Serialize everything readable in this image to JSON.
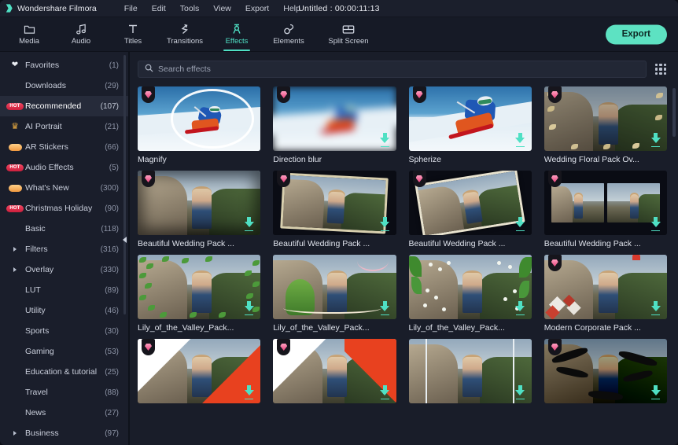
{
  "app": {
    "brand": "Wondershare Filmora",
    "project_title": "Untitled : 00:00:11:13",
    "accent": "#4fe0c4",
    "badge_color": "#e8447e",
    "hot_color": "#cc1f3c"
  },
  "menu": [
    {
      "label": "File"
    },
    {
      "label": "Edit"
    },
    {
      "label": "Tools"
    },
    {
      "label": "View"
    },
    {
      "label": "Export"
    },
    {
      "label": "Help"
    }
  ],
  "toolbar": {
    "tabs": [
      {
        "label": "Media",
        "icon": "folder-icon",
        "active": false
      },
      {
        "label": "Audio",
        "icon": "music-note-icon",
        "active": false
      },
      {
        "label": "Titles",
        "icon": "text-t-icon",
        "active": false
      },
      {
        "label": "Transitions",
        "icon": "transitions-icon",
        "active": false
      },
      {
        "label": "Effects",
        "icon": "effects-icon",
        "active": true
      },
      {
        "label": "Elements",
        "icon": "elements-icon",
        "active": false
      },
      {
        "label": "Split Screen",
        "icon": "split-screen-icon",
        "active": false
      }
    ],
    "export_label": "Export"
  },
  "search": {
    "placeholder": "Search effects",
    "value": ""
  },
  "sidebar": {
    "items": [
      {
        "label": "Favorites",
        "count": "(1)",
        "icon": "heart-icon",
        "selected": false,
        "expandable": false
      },
      {
        "label": "Downloads",
        "count": "(29)",
        "icon": "none",
        "selected": false,
        "expandable": false
      },
      {
        "label": "Recommended",
        "count": "(107)",
        "icon": "hot-badge",
        "selected": true,
        "expandable": false
      },
      {
        "label": "AI Portrait",
        "count": "(21)",
        "icon": "crown-icon",
        "selected": false,
        "expandable": false
      },
      {
        "label": "AR Stickers",
        "count": "(66)",
        "icon": "pill-icon",
        "selected": false,
        "expandable": false
      },
      {
        "label": "Audio Effects",
        "count": "(5)",
        "icon": "hot-badge",
        "selected": false,
        "expandable": false
      },
      {
        "label": "What's New",
        "count": "(300)",
        "icon": "pill-icon",
        "selected": false,
        "expandable": false
      },
      {
        "label": "Christmas Holiday",
        "count": "(90)",
        "icon": "hot-badge",
        "selected": false,
        "expandable": false
      },
      {
        "label": "Basic",
        "count": "(118)",
        "icon": "none",
        "selected": false,
        "expandable": false
      },
      {
        "label": "Filters",
        "count": "(316)",
        "icon": "caret-icon",
        "selected": false,
        "expandable": true
      },
      {
        "label": "Overlay",
        "count": "(330)",
        "icon": "caret-icon",
        "selected": false,
        "expandable": true
      },
      {
        "label": "LUT",
        "count": "(89)",
        "icon": "none",
        "selected": false,
        "expandable": false
      },
      {
        "label": "Utility",
        "count": "(46)",
        "icon": "none",
        "selected": false,
        "expandable": false
      },
      {
        "label": "Sports",
        "count": "(30)",
        "icon": "none",
        "selected": false,
        "expandable": false
      },
      {
        "label": "Gaming",
        "count": "(53)",
        "icon": "none",
        "selected": false,
        "expandable": false
      },
      {
        "label": "Education & tutorial",
        "count": "(25)",
        "icon": "none",
        "selected": false,
        "expandable": false
      },
      {
        "label": "Travel",
        "count": "(88)",
        "icon": "none",
        "selected": false,
        "expandable": false
      },
      {
        "label": "News",
        "count": "(27)",
        "icon": "none",
        "selected": false,
        "expandable": false
      },
      {
        "label": "Business",
        "count": "(97)",
        "icon": "caret-icon",
        "selected": false,
        "expandable": true
      }
    ]
  },
  "effects": {
    "cards": [
      {
        "label": "Magnify",
        "art": "ski-magnify",
        "pro": true,
        "download": false
      },
      {
        "label": "Direction blur",
        "art": "ski-blur",
        "pro": true,
        "download": true
      },
      {
        "label": "Spherize",
        "art": "ski-spherize",
        "pro": true,
        "download": true
      },
      {
        "label": "Wedding Floral Pack Ov...",
        "art": "wedding-floral",
        "pro": true,
        "download": true
      },
      {
        "label": "Beautiful Wedding Pack ...",
        "art": "wedding-plain",
        "pro": true,
        "download": true
      },
      {
        "label": "Beautiful Wedding Pack ...",
        "art": "wedding-stack",
        "pro": true,
        "download": true
      },
      {
        "label": "Beautiful Wedding Pack ...",
        "art": "wedding-tilt",
        "pro": true,
        "download": true
      },
      {
        "label": "Beautiful Wedding Pack ...",
        "art": "wedding-split",
        "pro": true,
        "download": true
      },
      {
        "label": "Lily_of_the_Valley_Pack...",
        "art": "lily-leaves",
        "pro": false,
        "download": true
      },
      {
        "label": "Lily_of_the_Valley_Pack...",
        "art": "lily-flower",
        "pro": false,
        "download": true
      },
      {
        "label": "Lily_of_the_Valley_Pack...",
        "art": "lily-dots",
        "pro": false,
        "download": true
      },
      {
        "label": "Modern Corporate Pack ...",
        "art": "corporate",
        "pro": true,
        "download": true
      },
      {
        "label": "",
        "art": "wipe-white",
        "pro": true,
        "download": true
      },
      {
        "label": "",
        "art": "wipe-red",
        "pro": true,
        "download": true
      },
      {
        "label": "",
        "art": "bars",
        "pro": false,
        "download": true
      },
      {
        "label": "",
        "art": "sketch",
        "pro": true,
        "download": true
      }
    ]
  }
}
